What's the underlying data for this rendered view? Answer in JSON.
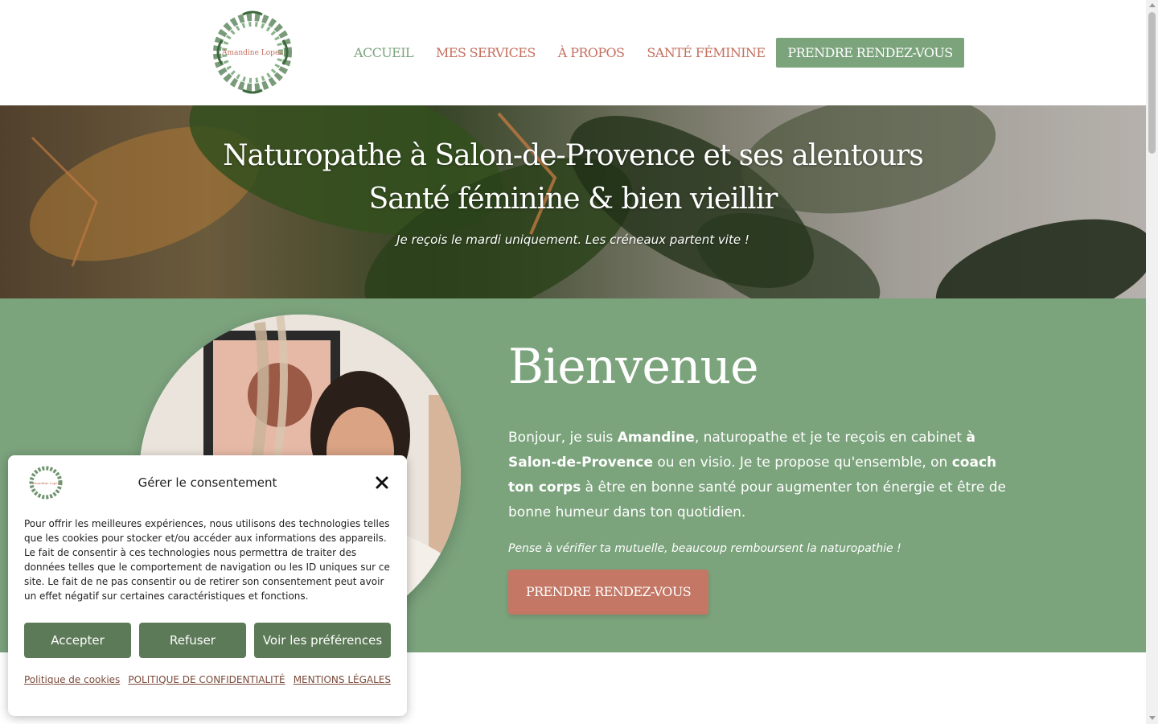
{
  "header": {
    "logo_name": "Amandine Lopez",
    "nav": [
      {
        "label": "ACCUEIL",
        "active": true
      },
      {
        "label": "MES SERVICES",
        "active": false
      },
      {
        "label": "À PROPOS",
        "active": false
      },
      {
        "label": "SANTÉ FÉMININE",
        "active": false
      }
    ],
    "cta_label": "PRENDRE RENDEZ-VOUS"
  },
  "hero": {
    "title_line1": "Naturopathe à Salon-de-Provence et ses alentours",
    "title_line2": "Santé féminine & bien vieillir",
    "subtitle": "Je reçois le mardi uniquement. Les créneaux partent vite !"
  },
  "welcome": {
    "title": "Bienvenue",
    "p1": "Bonjour, je suis ",
    "b1": "Amandine",
    "p2": ", naturopathe et je te reçois en cabinet ",
    "b2": "à Salon-de-Provence",
    "p3": " ou en visio. Je te propose qu'ensemble, on ",
    "b3": "coach ton corps",
    "p4": " à être en bonne santé pour augmenter ton énergie et être de bonne humeur dans ton quotidien.",
    "note": "Pense à vérifier ta mutuelle, beaucoup remboursent la naturopathie !",
    "cta_label": "PRENDRE RENDEZ-VOUS"
  },
  "consent": {
    "logo_name": "Amandine Lopez",
    "title": "Gérer le consentement",
    "body": "Pour offrir les meilleures expériences, nous utilisons des technologies telles que les cookies pour stocker et/ou accéder aux informations des appareils. Le fait de consentir à ces technologies nous permettra de traiter des données telles que le comportement de navigation ou les ID uniques sur ce site. Le fait de ne pas consentir ou de retirer son consentement peut avoir un effet négatif sur certaines caractéristiques et fonctions.",
    "accept_label": "Accepter",
    "refuse_label": "Refuser",
    "prefs_label": "Voir les préférences",
    "links": [
      "Politique de cookies",
      "POLITIQUE DE CONFIDENTIALITÉ",
      "MENTIONS LÉGALES"
    ]
  },
  "colors": {
    "green": "#7ba37c",
    "terracotta": "#c46f5e",
    "dark_green": "#5d7a58",
    "white": "#ffffff"
  },
  "icons": [
    "close-icon",
    "logo-wreath-icon"
  ]
}
